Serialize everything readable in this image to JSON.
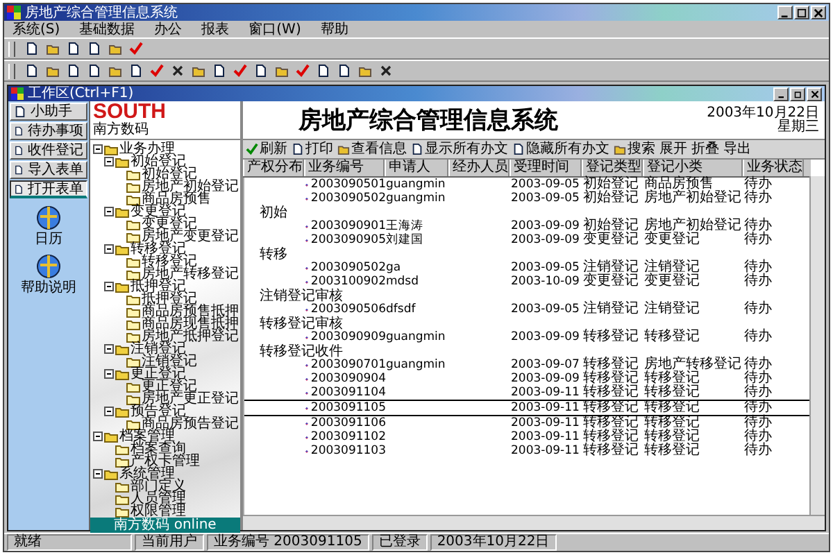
{
  "window": {
    "title": "房地产综合管理信息系统"
  },
  "menu": [
    "系统(S)",
    "基础数据",
    "办公",
    "报表",
    "窗口(W)",
    "帮助"
  ],
  "workspace": {
    "title": "工作区(Ctrl+F1)"
  },
  "nav_buttons": [
    {
      "label": "小助手",
      "selected": false
    },
    {
      "label": "待办事项",
      "selected": false
    },
    {
      "label": "收件登记",
      "selected": false
    },
    {
      "label": "导入表单",
      "selected": false
    },
    {
      "label": "打开表单",
      "selected": true
    }
  ],
  "shortcuts": [
    {
      "label": "日历"
    },
    {
      "label": "帮助说明"
    }
  ],
  "logo": {
    "brand": "SOUTH",
    "subtitle": "南方数码"
  },
  "tree": [
    {
      "label": "业务办理",
      "expanded": true,
      "children": [
        {
          "label": "初始登记",
          "expanded": true,
          "children": [
            {
              "label": "初始登记"
            },
            {
              "label": "房地产初始登记"
            },
            {
              "label": "商品房预售"
            }
          ]
        },
        {
          "label": "变更登记",
          "expanded": true,
          "children": [
            {
              "label": "变更登记"
            },
            {
              "label": "房地产变更登记"
            }
          ]
        },
        {
          "label": "转移登记",
          "expanded": true,
          "children": [
            {
              "label": "转移登记"
            },
            {
              "label": "房地产转移登记"
            }
          ]
        },
        {
          "label": "抵押登记",
          "expanded": true,
          "children": [
            {
              "label": "抵押登记"
            },
            {
              "label": "商品房预售抵押"
            },
            {
              "label": "商品房现售抵押"
            },
            {
              "label": "房地产抵押登记"
            }
          ]
        },
        {
          "label": "注销登记",
          "expanded": true,
          "children": [
            {
              "label": "注销登记"
            }
          ]
        },
        {
          "label": "更正登记",
          "expanded": true,
          "children": [
            {
              "label": "更正登记"
            },
            {
              "label": "房地产更正登记"
            }
          ]
        },
        {
          "label": "预告登记",
          "expanded": true,
          "children": [
            {
              "label": "商品房预告登记"
            }
          ]
        }
      ]
    },
    {
      "label": "档案管理",
      "expanded": true,
      "children": [
        {
          "label": "档案查询"
        },
        {
          "label": "产权卡管理"
        }
      ]
    },
    {
      "label": "系统管理",
      "expanded": true,
      "children": [
        {
          "label": "部门定义"
        },
        {
          "label": "人员管理"
        },
        {
          "label": "权限管理"
        }
      ]
    }
  ],
  "tree_footer": "南方数码 online",
  "header": {
    "title": "房地产综合管理信息系统",
    "date": "2003年10月22日",
    "weekday": "星期三"
  },
  "toolbar": [
    "刷新",
    "打印",
    "查看信息",
    "显示所有办文",
    "隐藏所有办文",
    "搜索",
    "展开",
    "折叠",
    "导出"
  ],
  "table": {
    "columns": [
      "产权分布",
      "业务编号",
      "申请人",
      "经办人员",
      "受理时间",
      "登记类型",
      "登记小类",
      "业务状态"
    ],
    "rows": [
      {
        "kind": "record",
        "selected": false,
        "number": "2003090501",
        "applicant": "guangmin",
        "date": "2003-09-05",
        "type": "初始登记",
        "subtype": "商品房预售",
        "status": "待办"
      },
      {
        "kind": "record",
        "selected": false,
        "number": "2003090502",
        "applicant": "guangmin",
        "date": "2003-09-05",
        "type": "初始登记",
        "subtype": "房地产初始登记",
        "status": "待办"
      },
      {
        "kind": "group",
        "label": "初始"
      },
      {
        "kind": "record",
        "selected": false,
        "number": "2003090901",
        "applicant": "王海涛",
        "date": "2003-09-09",
        "type": "初始登记",
        "subtype": "房地产初始登记",
        "status": "待办"
      },
      {
        "kind": "record",
        "selected": false,
        "number": "2003090905",
        "applicant": "刘建国",
        "date": "2003-09-09",
        "type": "变更登记",
        "subtype": "变更登记",
        "status": "待办"
      },
      {
        "kind": "group",
        "label": "转移"
      },
      {
        "kind": "record",
        "selected": false,
        "number": "2003090502",
        "applicant": "ga",
        "date": "2003-09-05",
        "type": "注销登记",
        "subtype": "注销登记",
        "status": "待办"
      },
      {
        "kind": "record",
        "selected": false,
        "number": "2003100902",
        "applicant": "mdsd",
        "date": "2003-10-09",
        "type": "变更登记",
        "subtype": "变更登记",
        "status": "待办"
      },
      {
        "kind": "group",
        "label": "注销登记审核"
      },
      {
        "kind": "record",
        "selected": false,
        "number": "2003090506",
        "applicant": "dfsdf",
        "date": "2003-09-05",
        "type": "注销登记",
        "subtype": "注销登记",
        "status": "待办"
      },
      {
        "kind": "group",
        "label": "转移登记审核"
      },
      {
        "kind": "record",
        "selected": false,
        "number": "2003090909",
        "applicant": "guangmin",
        "date": "2003-09-09",
        "type": "转移登记",
        "subtype": "转移登记",
        "status": "待办"
      },
      {
        "kind": "group",
        "label": "转移登记收件"
      },
      {
        "kind": "record",
        "selected": false,
        "number": "2003090701",
        "applicant": "guangmin",
        "date": "2003-09-07",
        "type": "转移登记",
        "subtype": "房地产转移登记",
        "status": "待办"
      },
      {
        "kind": "record",
        "selected": false,
        "number": "2003090904",
        "date": "2003-09-09",
        "type": "转移登记",
        "subtype": "转移登记",
        "status": "待办"
      },
      {
        "kind": "record",
        "selected": false,
        "number": "2003091104",
        "date": "2003-09-11",
        "type": "转移登记",
        "subtype": "转移登记",
        "status": "待办"
      },
      {
        "kind": "record",
        "selected": true,
        "number": "2003091105",
        "date": "2003-09-11",
        "type": "转移登记",
        "subtype": "转移登记",
        "status": "待办"
      },
      {
        "kind": "record",
        "selected": false,
        "number": "2003091106",
        "date": "2003-09-11",
        "type": "转移登记",
        "subtype": "转移登记",
        "status": "待办"
      },
      {
        "kind": "record",
        "selected": false,
        "number": "2003091102",
        "date": "2003-09-11",
        "type": "转移登记",
        "subtype": "转移登记",
        "status": "待办"
      },
      {
        "kind": "record",
        "selected": false,
        "number": "2003091103",
        "date": "2003-09-11",
        "type": "转移登记",
        "subtype": "转移登记",
        "status": "待办"
      }
    ]
  },
  "status_bar": {
    "left": "就绪",
    "cells": [
      "当前用户",
      "业务编号 2003091105",
      "已登录",
      "2003年10月22日"
    ]
  }
}
